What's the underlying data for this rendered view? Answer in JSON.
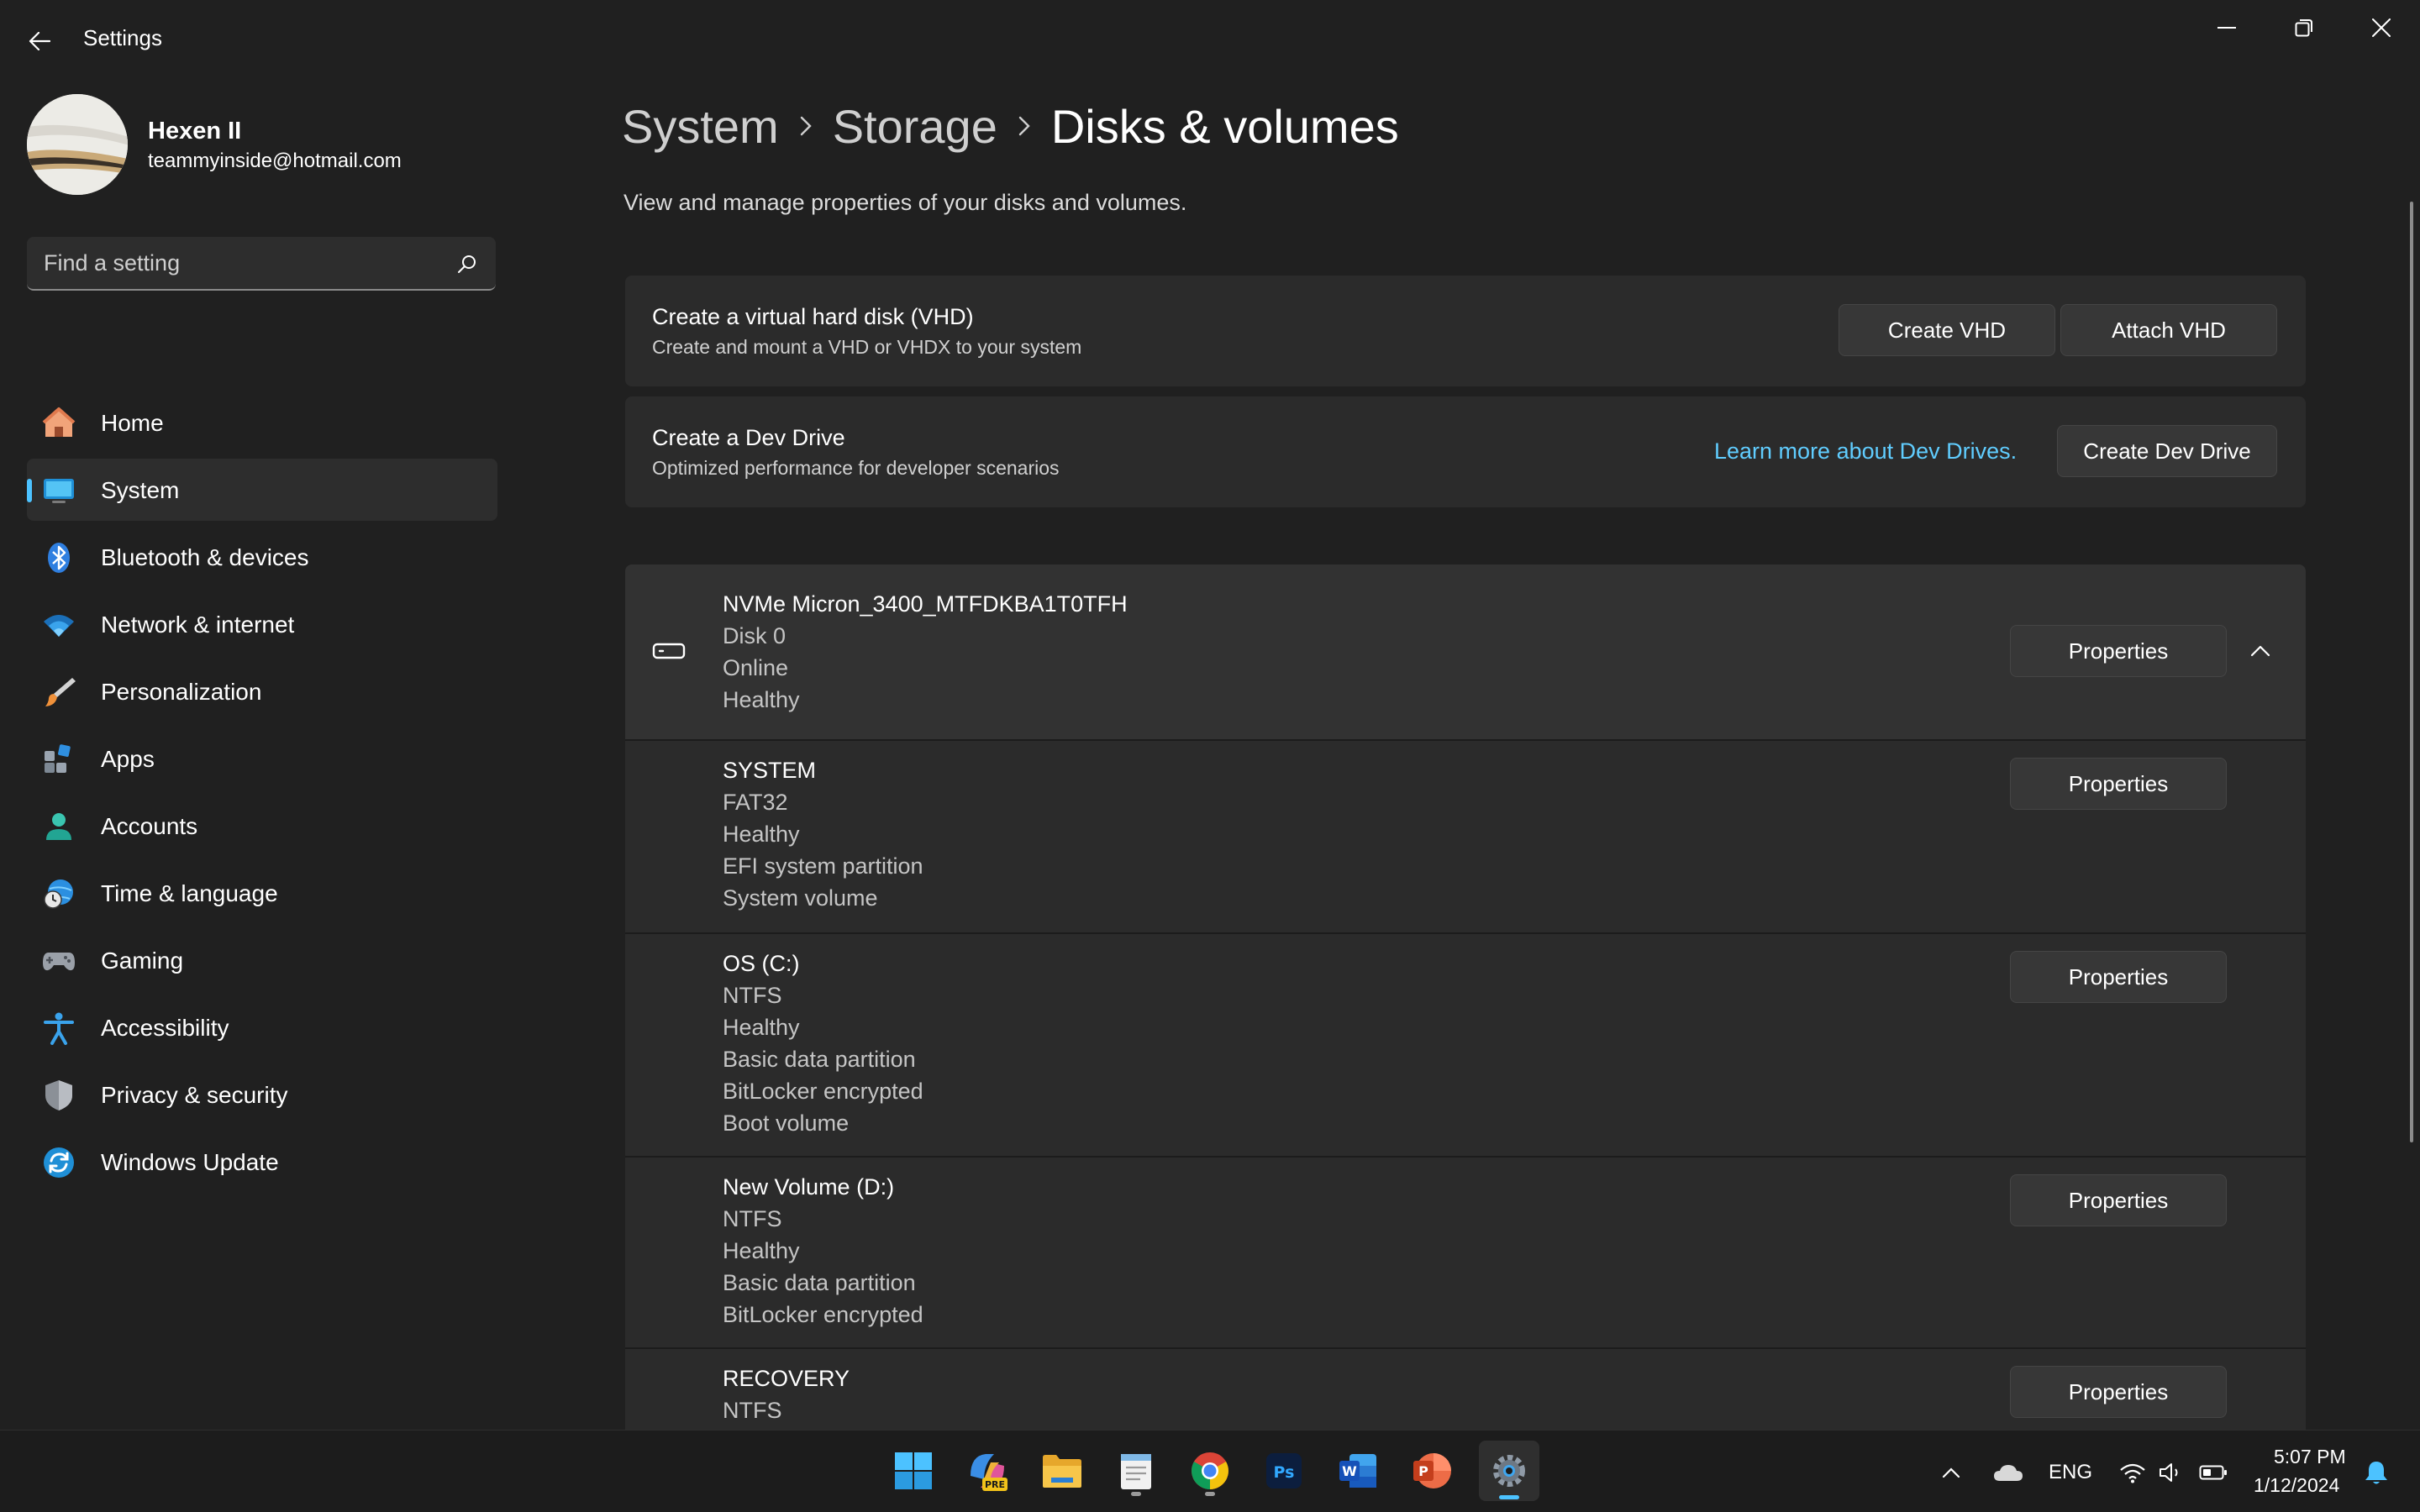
{
  "window": {
    "title": "Settings"
  },
  "user": {
    "name": "Hexen II",
    "email": "teammyinside@hotmail.com"
  },
  "search": {
    "placeholder": "Find a setting"
  },
  "sidebar": {
    "items": [
      {
        "label": "Home",
        "icon": "home-icon",
        "selected": false
      },
      {
        "label": "System",
        "icon": "monitor-icon",
        "selected": true
      },
      {
        "label": "Bluetooth & devices",
        "icon": "bluetooth-icon",
        "selected": false
      },
      {
        "label": "Network & internet",
        "icon": "wifi-icon",
        "selected": false
      },
      {
        "label": "Personalization",
        "icon": "brush-icon",
        "selected": false
      },
      {
        "label": "Apps",
        "icon": "apps-icon",
        "selected": false
      },
      {
        "label": "Accounts",
        "icon": "person-icon",
        "selected": false
      },
      {
        "label": "Time & language",
        "icon": "globe-clock-icon",
        "selected": false
      },
      {
        "label": "Gaming",
        "icon": "gamepad-icon",
        "selected": false
      },
      {
        "label": "Accessibility",
        "icon": "accessibility-icon",
        "selected": false
      },
      {
        "label": "Privacy & security",
        "icon": "shield-icon",
        "selected": false
      },
      {
        "label": "Windows Update",
        "icon": "update-icon",
        "selected": false
      }
    ]
  },
  "breadcrumb": {
    "items": [
      "System",
      "Storage"
    ],
    "current": "Disks & volumes"
  },
  "page": {
    "description": "View and manage properties of your disks and volumes."
  },
  "vhd_card": {
    "title": "Create a virtual hard disk (VHD)",
    "subtitle": "Create and mount a VHD or VHDX to your system",
    "create_label": "Create VHD",
    "attach_label": "Attach VHD"
  },
  "devdrive_card": {
    "title": "Create a Dev Drive",
    "subtitle": "Optimized performance for developer scenarios",
    "link_label": "Learn more about Dev Drives.",
    "button_label": "Create Dev Drive"
  },
  "disk": {
    "name": "NVMe Micron_3400_MTFDKBA1T0TFH",
    "number": "Disk 0",
    "status": "Online",
    "health": "Healthy",
    "properties_label": "Properties",
    "expanded": true
  },
  "volumes": [
    {
      "name": "SYSTEM",
      "details": [
        "FAT32",
        "Healthy",
        "EFI system partition",
        "System volume"
      ],
      "properties_label": "Properties"
    },
    {
      "name": "OS (C:)",
      "details": [
        "NTFS",
        "Healthy",
        "Basic data partition",
        "BitLocker encrypted",
        "Boot volume"
      ],
      "properties_label": "Properties"
    },
    {
      "name": "New Volume (D:)",
      "details": [
        "NTFS",
        "Healthy",
        "Basic data partition",
        "BitLocker encrypted"
      ],
      "properties_label": "Properties"
    },
    {
      "name": "RECOVERY",
      "details": [
        "NTFS"
      ],
      "properties_label": "Properties"
    }
  ],
  "taskbar": {
    "apps": [
      "windows-start-icon",
      "copilot-pre-icon",
      "file-explorer-icon",
      "notepad-icon",
      "chrome-icon",
      "photoshop-icon",
      "word-icon",
      "powerpoint-icon",
      "settings-icon"
    ],
    "language": "ENG",
    "time": "5:07 PM",
    "date": "1/12/2024"
  },
  "colors": {
    "accent": "#4cc2ff",
    "link": "#60cdff",
    "background": "#202020",
    "card": "#2b2b2b"
  }
}
